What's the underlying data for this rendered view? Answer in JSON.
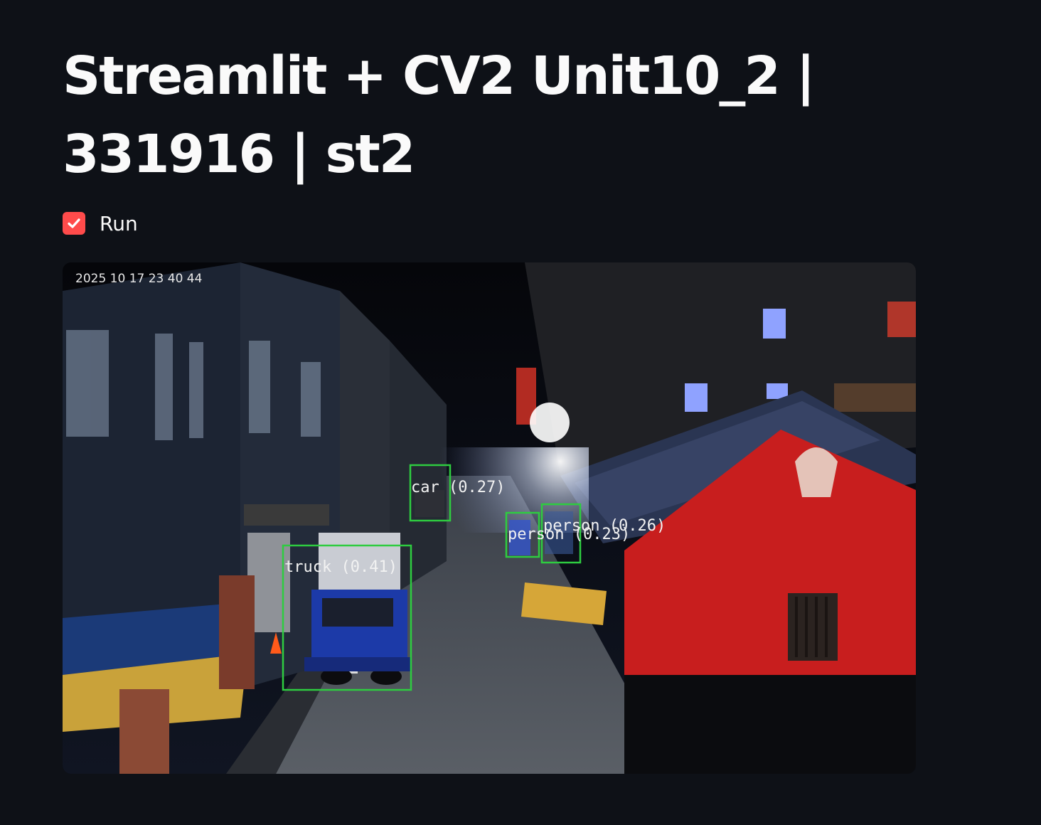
{
  "header": {
    "title": "Streamlit + CV2 Unit10_2 | 331916 | st2"
  },
  "controls": {
    "run_label": "Run",
    "run_checked": true
  },
  "video": {
    "timestamp": "2025 10 17 23 40 44",
    "detections": [
      {
        "label": "car (0.27)"
      },
      {
        "label": "truck (0.41)"
      },
      {
        "label": "person (0.26)"
      },
      {
        "label": "person (0.23)"
      }
    ]
  },
  "colors": {
    "background": "#0e1117",
    "accent": "#ff4b4b",
    "box": "#2ecc40"
  }
}
